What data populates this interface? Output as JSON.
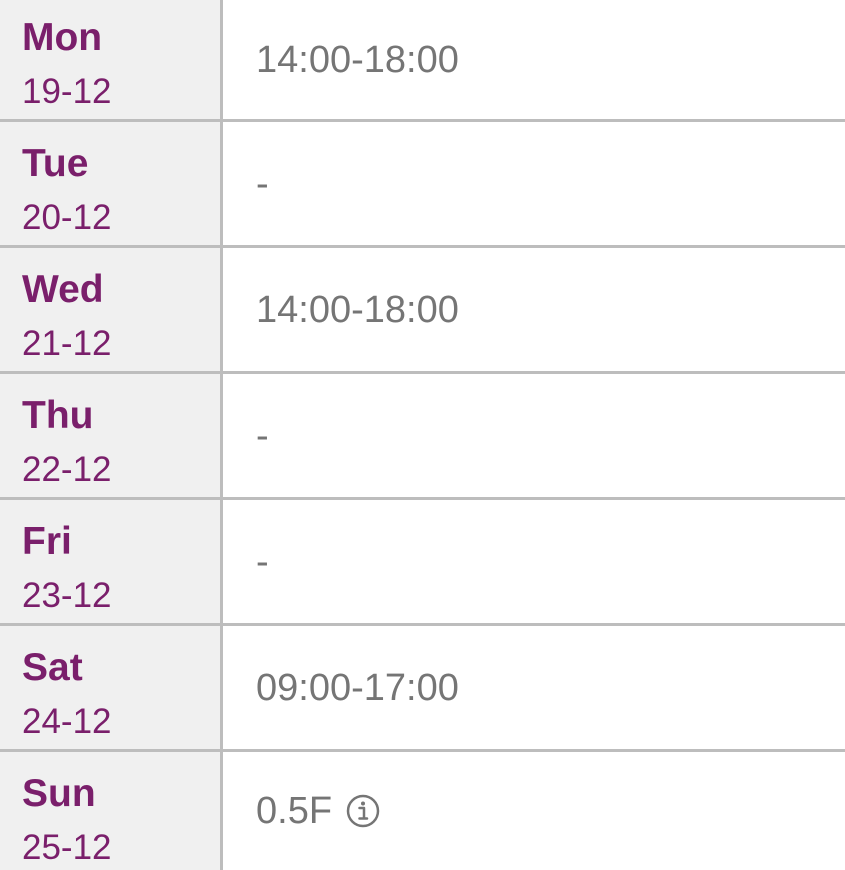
{
  "schedule": {
    "rows": [
      {
        "day": "Mon",
        "date": "19-12",
        "hours": "14:00-18:00",
        "has_info": false
      },
      {
        "day": "Tue",
        "date": "20-12",
        "hours": "-",
        "has_info": false
      },
      {
        "day": "Wed",
        "date": "21-12",
        "hours": "14:00-18:00",
        "has_info": false
      },
      {
        "day": "Thu",
        "date": "22-12",
        "hours": "-",
        "has_info": false
      },
      {
        "day": "Fri",
        "date": "23-12",
        "hours": "-",
        "has_info": false
      },
      {
        "day": "Sat",
        "date": "24-12",
        "hours": "09:00-17:00",
        "has_info": false
      },
      {
        "day": "Sun",
        "date": "25-12",
        "hours": "0.5F",
        "has_info": true,
        "icon": "info-icon"
      }
    ]
  },
  "colors": {
    "day_text": "#7a1f6b",
    "hours_text": "#757575",
    "day_column_bg": "#f0f0f0",
    "divider": "#bdbdbd"
  }
}
